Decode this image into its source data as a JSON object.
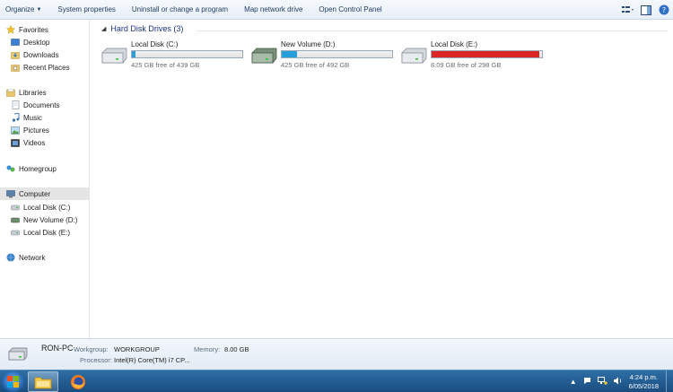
{
  "toolbar": {
    "organize": "Organize",
    "system_properties": "System properties",
    "uninstall": "Uninstall or change a program",
    "map_drive": "Map network drive",
    "control_panel": "Open Control Panel"
  },
  "nav": {
    "favorites": "Favorites",
    "desktop": "Desktop",
    "downloads": "Downloads",
    "recent_places": "Recent Places",
    "libraries": "Libraries",
    "documents": "Documents",
    "music": "Music",
    "pictures": "Pictures",
    "videos": "Videos",
    "homegroup": "Homegroup",
    "computer": "Computer",
    "drive_c": "Local Disk (C:)",
    "drive_d": "New Volume (D:)",
    "drive_e": "Local Disk (E:)",
    "network": "Network"
  },
  "group": {
    "title": "Hard Disk Drives (3)"
  },
  "drives": [
    {
      "name": "Local Disk (C:)",
      "free_text": "425 GB free of 439 GB",
      "used_fraction": 0.032,
      "bar_color": "#26a0da"
    },
    {
      "name": "New Volume (D:)",
      "free_text": "425 GB free of 492 GB",
      "used_fraction": 0.136,
      "bar_color": "#26a0da"
    },
    {
      "name": "Local Disk (E:)",
      "free_text": "8.09 GB free of 298 GB",
      "used_fraction": 0.973,
      "bar_color": "#da2626"
    }
  ],
  "details": {
    "pc_name": "RON-PC",
    "workgroup_label": "Workgroup:",
    "workgroup_value": "WORKGROUP",
    "memory_label": "Memory:",
    "memory_value": "8.00 GB",
    "processor_label": "Processor:",
    "processor_value": "Intel(R) Core(TM) i7 CP..."
  },
  "taskbar": {
    "time": "4:24 p.m.",
    "date": "6/05/2018"
  }
}
